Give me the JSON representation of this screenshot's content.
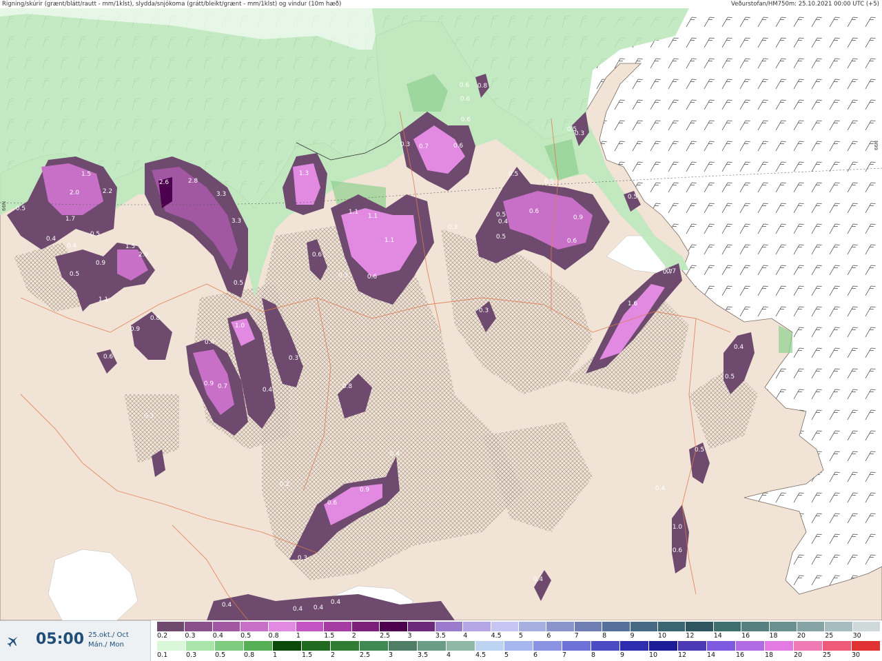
{
  "header": {
    "left_text": "Rigning/skúrir (grænt/blátt/rautt - mm/1klst), slydda/snjókoma (grátt/bleikt/grænt - mm/1klst) og vindur (10m hæð)",
    "right_text": "Veðurstofan/HM750m: 25.10.2021 00:00 UTC (+5)"
  },
  "map": {
    "lat_label_right": "66N",
    "lat_label_left": "66N",
    "precip_labels": [
      {
        "text": "1.5"
      },
      {
        "text": "2.0"
      },
      {
        "text": "2.2"
      },
      {
        "text": "0.5"
      },
      {
        "text": "1.7"
      },
      {
        "text": "0.4"
      },
      {
        "text": "0.4"
      },
      {
        "text": "0.5"
      },
      {
        "text": "1.5"
      },
      {
        "text": "2.0"
      },
      {
        "text": "0.9"
      },
      {
        "text": "0.5"
      },
      {
        "text": "1.1"
      },
      {
        "text": "2.6"
      },
      {
        "text": "2.8"
      },
      {
        "text": "3.3"
      },
      {
        "text": "3.3"
      },
      {
        "text": "0.5"
      },
      {
        "text": "1.3"
      },
      {
        "text": "1.1"
      },
      {
        "text": "1.1"
      },
      {
        "text": "1.1"
      },
      {
        "text": "0.6"
      },
      {
        "text": "0.3"
      },
      {
        "text": "0.7"
      },
      {
        "text": "0.6"
      },
      {
        "text": "0.6"
      },
      {
        "text": "0.5"
      },
      {
        "text": "0.5"
      },
      {
        "text": "0.6"
      },
      {
        "text": "0.4"
      },
      {
        "text": "0.5"
      },
      {
        "text": "0.9"
      },
      {
        "text": "0.5"
      },
      {
        "text": "0.6"
      },
      {
        "text": "0.3"
      },
      {
        "text": "1.6"
      },
      {
        "text": "0.7"
      },
      {
        "text": "0.8"
      },
      {
        "text": "0.9"
      },
      {
        "text": "0.6"
      },
      {
        "text": "0.4"
      },
      {
        "text": "0.9"
      },
      {
        "text": "0.7"
      },
      {
        "text": "1.0"
      },
      {
        "text": "0.3"
      },
      {
        "text": "0.8"
      },
      {
        "text": "0.4"
      },
      {
        "text": "0.3"
      },
      {
        "text": "0.6"
      },
      {
        "text": "0.9"
      },
      {
        "text": "0.4"
      },
      {
        "text": "0.3"
      },
      {
        "text": "0.4"
      },
      {
        "text": "0.4"
      },
      {
        "text": "0.4"
      },
      {
        "text": "0.4"
      },
      {
        "text": "0.4"
      },
      {
        "text": "0.5"
      },
      {
        "text": "0.5"
      },
      {
        "text": "1.0"
      },
      {
        "text": "0.6"
      },
      {
        "text": "0.4"
      },
      {
        "text": "0.3"
      },
      {
        "text": "0.2"
      },
      {
        "text": "0.4"
      },
      {
        "text": "0.5"
      },
      {
        "text": "0.3"
      },
      {
        "text": "0.6"
      },
      {
        "text": "0.7"
      },
      {
        "text": "0.5"
      },
      {
        "text": "0.6"
      },
      {
        "text": "0.8"
      },
      {
        "text": "0.3"
      },
      {
        "text": "0.6"
      }
    ]
  },
  "timebox": {
    "icon": "airplane-icon",
    "time": "05:00",
    "date_line1": "25.okt./ Oct",
    "date_line2": "Mán./ Mon"
  },
  "legend": {
    "snow_scale": {
      "ticks": [
        "0.2",
        "0.3",
        "0.4",
        "0.5",
        "0.8",
        "1",
        "1.5",
        "2",
        "2.5",
        "3",
        "3.5",
        "4",
        "4.5",
        "5",
        "6",
        "7",
        "8",
        "9",
        "10",
        "12",
        "14",
        "16",
        "18",
        "20",
        "25",
        "30"
      ],
      "colors": [
        "#6e4a6e",
        "#8b4f8b",
        "#a257a2",
        "#c870c8",
        "#e28ae2",
        "#c454c4",
        "#a43ca4",
        "#7b1f7b",
        "#4d004d",
        "#6b2a7a",
        "#9b7ccc",
        "#b3a5e6",
        "#c6c6f2",
        "#a7aee0",
        "#8995cc",
        "#6f7fb6",
        "#56709c",
        "#466a84",
        "#3b6570",
        "#2f5560",
        "#3d6f6f",
        "#567f80",
        "#6a9090",
        "#86a4a6",
        "#a6bcbe",
        "#cfd9da"
      ]
    },
    "rain_scale": {
      "ticks": [
        "0.1",
        "0.3",
        "0.5",
        "0.8",
        "1",
        "1.5",
        "2",
        "2.5",
        "3",
        "3.5",
        "4",
        "4.5",
        "5",
        "6",
        "7",
        "8",
        "9",
        "10",
        "12",
        "14",
        "16",
        "18",
        "20",
        "25",
        "30"
      ],
      "colors": [
        "#d9f7d9",
        "#a9e4a9",
        "#7fcb7f",
        "#55b055",
        "#0c4a0c",
        "#1f6a1f",
        "#2e7d32",
        "#3f8a53",
        "#4f7d66",
        "#6a9c86",
        "#8fb8a6",
        "#bcd3f2",
        "#a6b6ef",
        "#8b93e3",
        "#6d70d6",
        "#4c4bc4",
        "#2e2db0",
        "#1c1c96",
        "#4b3ab4",
        "#7d5ae0",
        "#b06ae2",
        "#e27ae2",
        "#f07ab4",
        "#f05a7a",
        "#e03232"
      ]
    }
  }
}
